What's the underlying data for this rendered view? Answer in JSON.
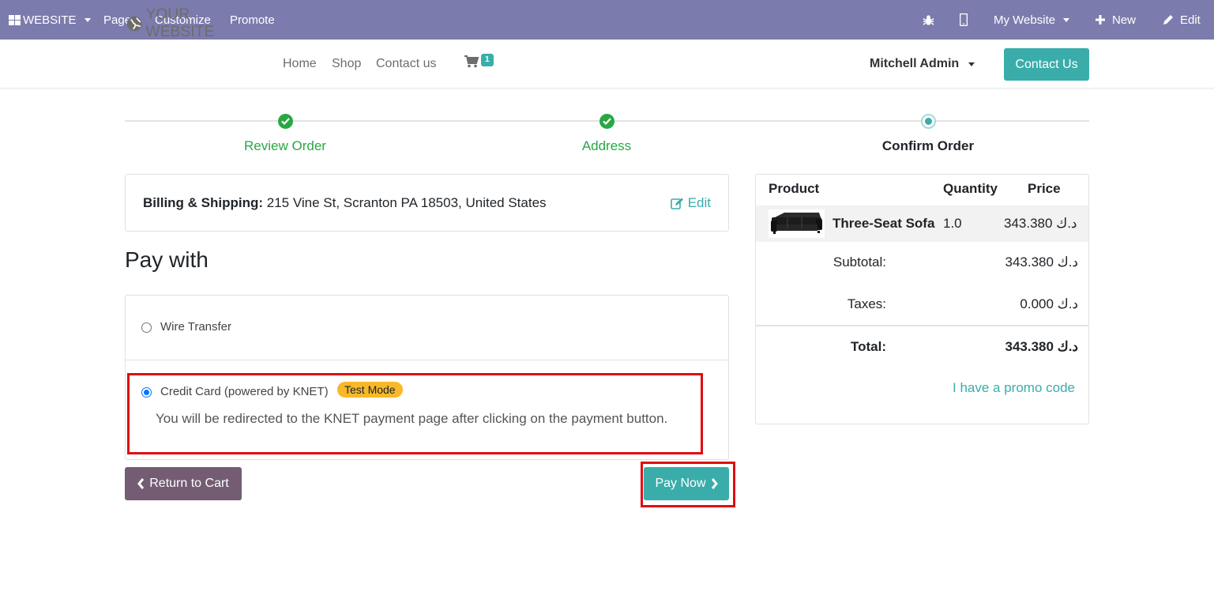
{
  "adminbar": {
    "website_label": "WEBSITE",
    "pages_label": "Pages",
    "customize_label": "Customize",
    "promote_label": "Promote",
    "my_website_label": "My Website",
    "new_label": "New",
    "edit_label": "Edit",
    "bar_color": "#7c7bad"
  },
  "header": {
    "logo_text": "YOUR WEBSITE",
    "nav": [
      "Home",
      "Shop",
      "Contact us"
    ],
    "cart_count": "1",
    "user_name": "Mitchell Admin",
    "contact_button": "Contact Us",
    "accent_color": "#3aadaa"
  },
  "progress": {
    "steps": [
      {
        "label": "Review Order",
        "state": "done"
      },
      {
        "label": "Address",
        "state": "done"
      },
      {
        "label": "Confirm Order",
        "state": "current"
      }
    ]
  },
  "billing": {
    "label": "Billing & Shipping:",
    "address": " 215 Vine St, Scranton PA 18503, United States",
    "edit_label": "Edit"
  },
  "payment": {
    "heading": "Pay with",
    "options": [
      {
        "label": "Wire Transfer",
        "selected": false
      },
      {
        "label": "Credit Card (powered by KNET)",
        "selected": true,
        "badge": "Test Mode"
      }
    ],
    "redirect_note": "You will be redirected to the KNET payment page after clicking on the payment button."
  },
  "actions": {
    "return_label": "Return to Cart",
    "pay_label": "Pay Now"
  },
  "summary": {
    "headers": {
      "product": "Product",
      "quantity": "Quantity",
      "price": "Price"
    },
    "item": {
      "name": "Three-Seat Sofa",
      "quantity": "1.0",
      "price": "343.380 د.ك"
    },
    "subtotal_label": "Subtotal:",
    "subtotal_value": "343.380 د.ك",
    "taxes_label": "Taxes:",
    "taxes_value": "0.000 د.ك",
    "total_label": "Total:",
    "total_value": "343.380 د.ك",
    "promo_link": "I have a promo code"
  }
}
